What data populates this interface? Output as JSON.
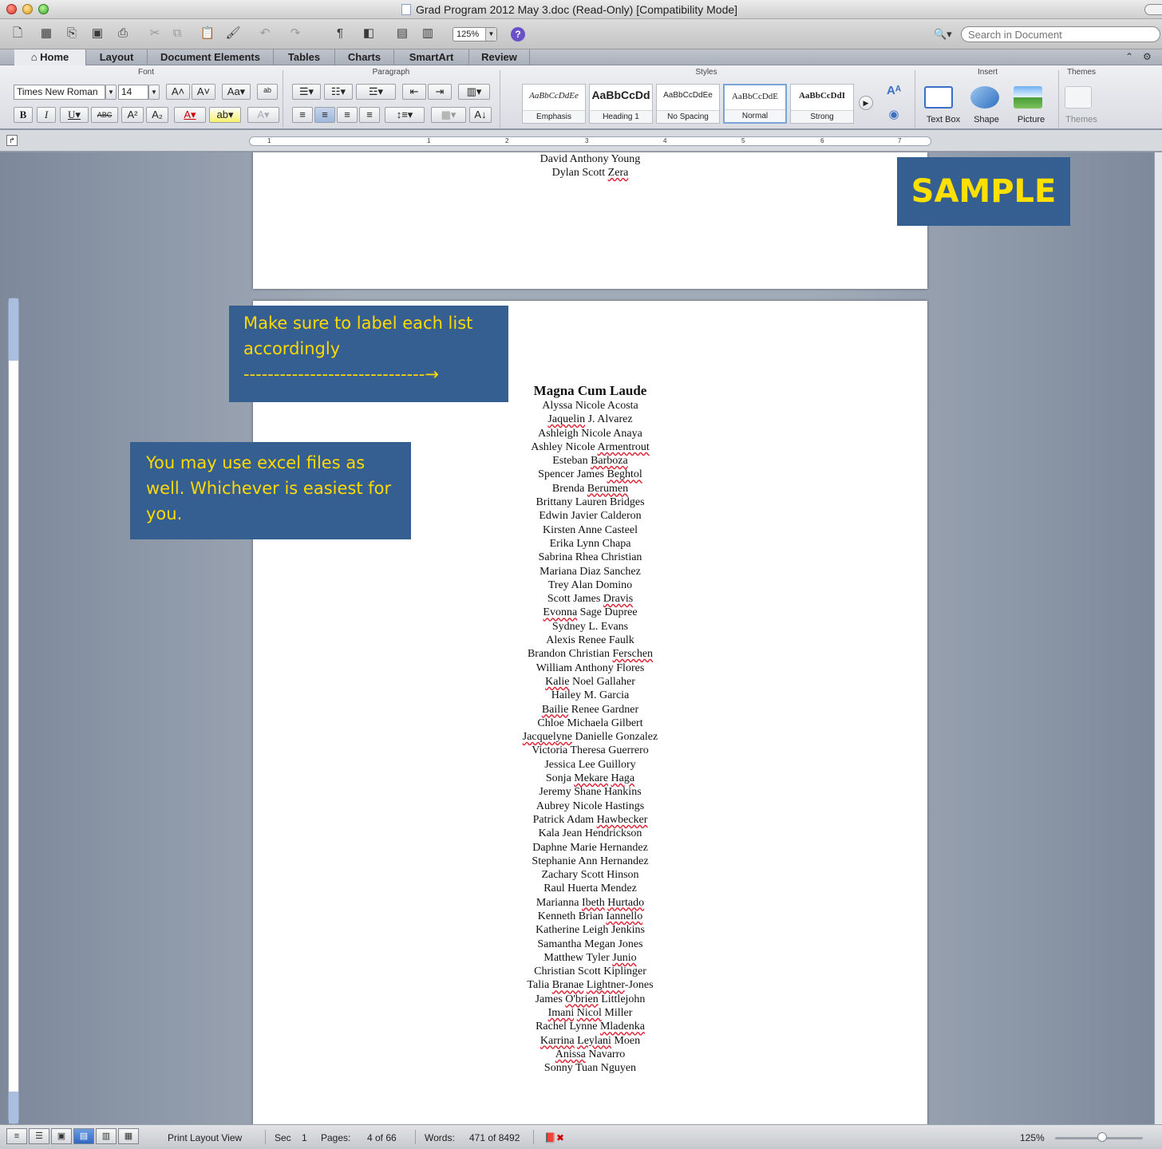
{
  "window": {
    "title": "Grad Program 2012 May 3.doc (Read-Only) [Compatibility Mode]"
  },
  "toolbar": {
    "zoom": "125%",
    "search_placeholder": "Search in Document"
  },
  "ribbon_tabs": [
    "Home",
    "Layout",
    "Document Elements",
    "Tables",
    "Charts",
    "SmartArt",
    "Review"
  ],
  "ribbon": {
    "groups": {
      "font": "Font",
      "paragraph": "Paragraph",
      "styles": "Styles",
      "insert": "Insert",
      "themes": "Themes"
    },
    "font_name": "Times New Roman",
    "font_size": "14",
    "styles": [
      {
        "sample": "AaBbCcDdEe",
        "name": "Emphasis"
      },
      {
        "sample": "AaBbCcDd",
        "name": "Heading 1"
      },
      {
        "sample": "AaBbCcDdEe",
        "name": "No Spacing"
      },
      {
        "sample": "AaBbCcDdE",
        "name": "Normal"
      },
      {
        "sample": "AaBbCcDdI",
        "name": "Strong"
      }
    ],
    "insert_items": [
      "Text Box",
      "Shape",
      "Picture"
    ],
    "themes_label": "Themes"
  },
  "ruler_ticks": [
    "1",
    "1",
    "2",
    "3",
    "4",
    "5",
    "6",
    "7"
  ],
  "page_prev": {
    "lines": [
      "David Anthony Young",
      "Dylan Scott Zera"
    ]
  },
  "callouts": {
    "sample": "SAMPLE",
    "label_note": "Make sure to label each list accordingly",
    "label_arrow": "------------------------------→",
    "excel_note": "You may use excel files as well. Whichever is easiest for you."
  },
  "page_current": {
    "heading": "Magna Cum Laude",
    "names": [
      "Alyssa Nicole Acosta",
      "Jaquelin J. Alvarez",
      "Ashleigh Nicole Anaya",
      "Ashley Nicole Armentrout",
      "Esteban Barboza",
      "Spencer James Beghtol",
      "Brenda Berumen",
      "Brittany Lauren Bridges",
      "Edwin Javier Calderon",
      "Kirsten Anne Casteel",
      "Erika Lynn Chapa",
      "Sabrina Rhea Christian",
      "Mariana Diaz Sanchez",
      "Trey Alan Domino",
      "Scott James Dravis",
      "Evonna Sage Dupree",
      "Sydney L. Evans",
      "Alexis Renee Faulk",
      "Brandon Christian Ferschen",
      "William Anthony Flores",
      "Kalie Noel Gallaher",
      "Hailey M. Garcia",
      "Bailie Renee Gardner",
      "Chloe Michaela Gilbert",
      "Jacquelyne Danielle Gonzalez",
      "Victoria Theresa Guerrero",
      "Jessica Lee Guillory",
      "Sonja Mekare Haga",
      "Jeremy Shane Hankins",
      "Aubrey Nicole Hastings",
      "Patrick Adam Hawbecker",
      "Kala Jean Hendrickson",
      "Daphne Marie Hernandez",
      "Stephanie Ann Hernandez",
      "Zachary Scott Hinson",
      "Raul Huerta Mendez",
      "Marianna Ibeth Hurtado",
      "Kenneth Brian Iannello",
      "Katherine Leigh Jenkins",
      "Samantha Megan Jones",
      "Matthew Tyler Junio",
      "Christian Scott Kiplinger",
      "Talia Branae Lightner-Jones",
      "James O'brien Littlejohn",
      "Imani Nicol Miller",
      "Rachel Lynne Mladenka",
      "Karrina Leylani Moen",
      "Anissa Navarro",
      "Sonny Tuan Nguyen"
    ]
  },
  "status": {
    "view": "Print Layout View",
    "sec_label": "Sec",
    "sec_value": "1",
    "pages_label": "Pages:",
    "pages_value": "4 of 66",
    "words_label": "Words:",
    "words_value": "471 of 8492",
    "zoom": "125%"
  }
}
